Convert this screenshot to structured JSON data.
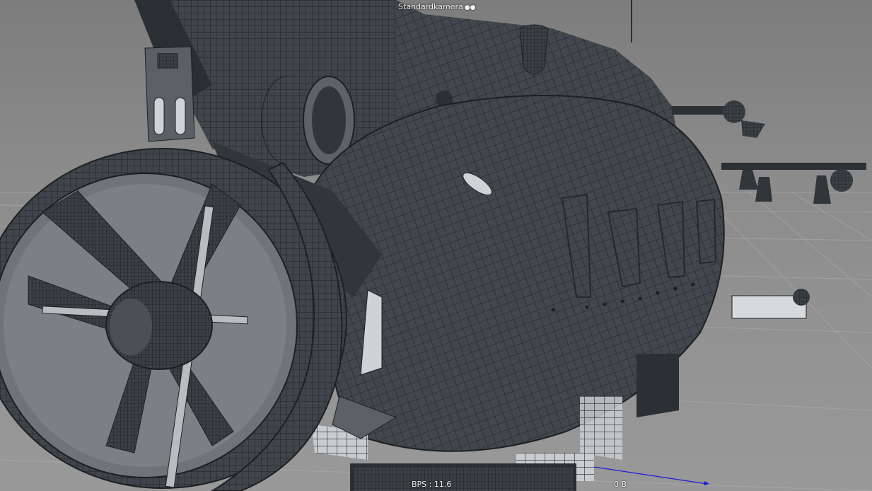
{
  "viewport": {
    "camera_label": "Standardkamera",
    "camera_icon": "camera-dots-icon",
    "fps_text": "BPS : 11.6",
    "memory_text": "0 B",
    "colors": {
      "background": "#8f8f8f",
      "model_fill": "#3c4246",
      "wire": "#1d2124",
      "grid": "#b5b5b5",
      "axis_x": "#1b1bd6",
      "hud_text": "#f0f0f0"
    }
  }
}
